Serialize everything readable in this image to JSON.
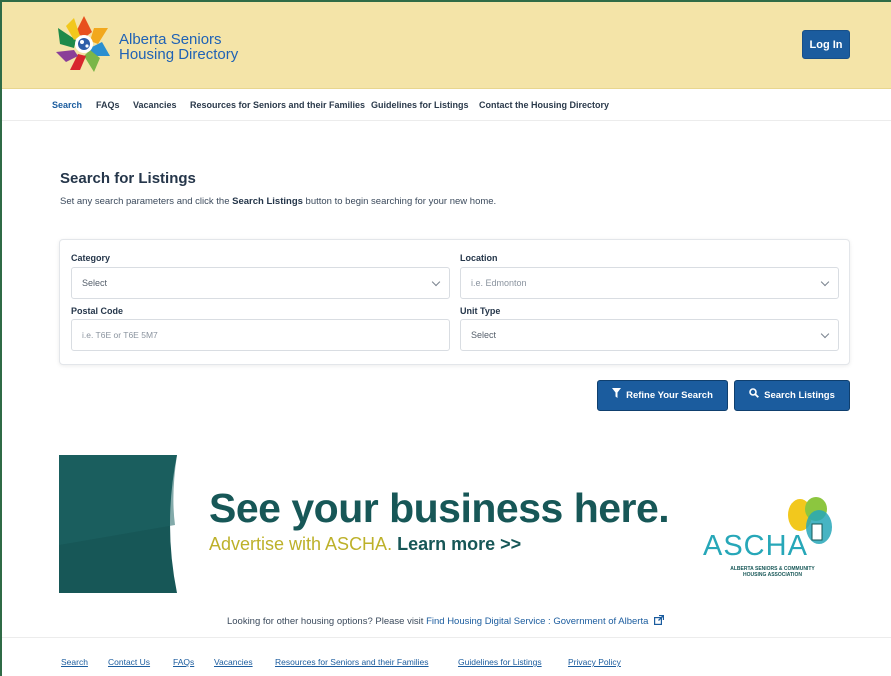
{
  "header": {
    "logo_line1": "Alberta Seniors",
    "logo_line2": "Housing Directory",
    "login_label": "Log In"
  },
  "nav": {
    "items": [
      {
        "label": "Search",
        "active": true
      },
      {
        "label": "FAQs"
      },
      {
        "label": "Vacancies"
      },
      {
        "label": "Resources for Seniors and their Families"
      },
      {
        "label": "Guidelines for Listings"
      },
      {
        "label": "Contact the Housing Directory"
      }
    ]
  },
  "search": {
    "title": "Search for Listings",
    "subtitle_pre": "Set any search parameters and click the ",
    "subtitle_bold": "Search Listings",
    "subtitle_post": " button to begin searching for your new home.",
    "category": {
      "label": "Category",
      "value": "Select"
    },
    "location": {
      "label": "Location",
      "placeholder": "i.e. Edmonton"
    },
    "postal_code": {
      "label": "Postal Code",
      "placeholder": "i.e. T6E or T6E 5M7"
    },
    "unit_type": {
      "label": "Unit Type",
      "value": "Select"
    },
    "refine_label": "Refine Your Search",
    "search_label": "Search Listings"
  },
  "ad": {
    "headline": "See your business here.",
    "sub_pre": "Advertise with ASCHA. ",
    "sub_link": "Learn more >>",
    "brand": "ASCHA",
    "brand_full_1": "ALBERTA SENIORS & COMMUNITY",
    "brand_full_2": "HOUSING ASSOCIATION"
  },
  "other_housing": {
    "text": "Looking for other housing options? Please visit ",
    "link": "Find Housing Digital Service : Government of Alberta"
  },
  "footer": {
    "links": [
      "Search",
      "Contact Us",
      "FAQs",
      "Vacancies",
      "Resources for Seniors and their Families",
      "Guidelines for Listings",
      "Privacy Policy"
    ]
  },
  "colors": {
    "header_bg": "#f4e4a8",
    "primary": "#1b5c9e",
    "ad_teal": "#175757",
    "ad_yellow": "#bdb12a",
    "ascha_blue": "#27a7b8"
  }
}
